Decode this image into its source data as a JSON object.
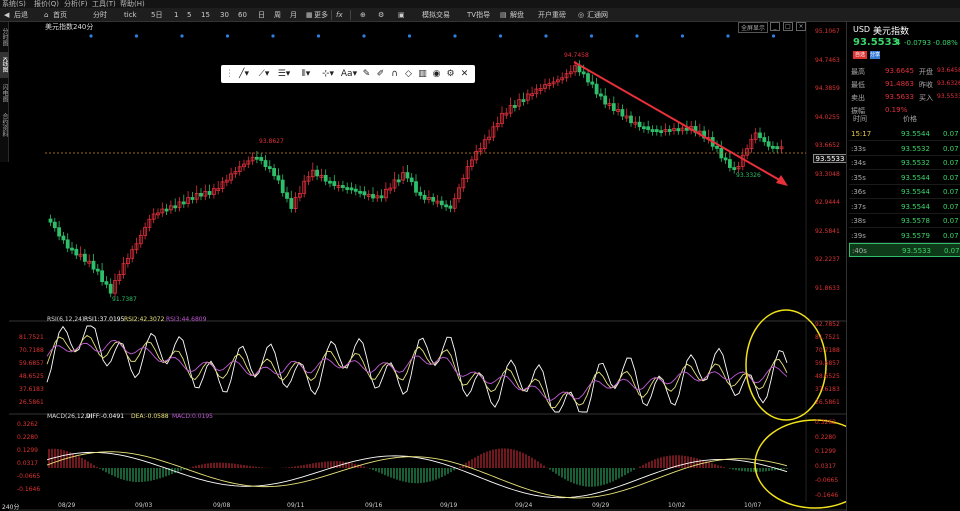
{
  "menubar": [
    "系统(S)",
    "报价(Q)",
    "分析(F)",
    "工具(T)",
    "帮助(H)"
  ],
  "toolbar": {
    "back": "后退",
    "home": "首页",
    "tab_fenshi": "分时",
    "tab_tick": "tick",
    "periods": [
      "5日",
      "1",
      "5",
      "15",
      "30",
      "60",
      "日",
      "周",
      "月"
    ],
    "more": "更多",
    "fx": "fx",
    "sim_trade": "模拟交易",
    "tv": "TV指导",
    "unlock": "解盘",
    "open": "开户重磅",
    "brand": "汇通网"
  },
  "left_tabs": [
    "分时图",
    "K线图",
    "闪电图",
    "合约资料"
  ],
  "main_chart": {
    "instrument": "美元指数",
    "period": "240分",
    "price_axis": [
      "95.1067",
      "94.7463",
      "94.3859",
      "94.0255",
      "93.6652",
      "93.3048",
      "92.9444",
      "92.5841",
      "92.2237",
      "91.8633"
    ],
    "current_price": "93.5533",
    "annotations": {
      "high": "94.7458",
      "peak1": "93.8627",
      "low": "91.7387",
      "recent_low": "93.3326"
    },
    "corner_label": "全屏显示"
  },
  "rsi": {
    "label": "RSI(6,12,24)",
    "rsi1": "RSI1:37.0195",
    "rsi2": "RSI2:42.3072",
    "rsi3": "RSI3:44.6809",
    "axis": [
      "92.7852",
      "81.7521",
      "70.7188",
      "59.6857",
      "48.6525",
      "37.6183",
      "26.5861"
    ]
  },
  "macd": {
    "label": "MACD(26,12,9)",
    "diff": "DIFF:-0.0491",
    "dea": "DEA:-0.0588",
    "macd": "MACD:0.0195",
    "axis": [
      "0.3262",
      "0.2280",
      "0.1299",
      "0.0317",
      "-0.0665",
      "-0.1646"
    ]
  },
  "dates": [
    "08/29",
    "09/03",
    "09/08",
    "09/11",
    "09/16",
    "09/19",
    "09/24",
    "09/29",
    "10/02",
    "10/07"
  ],
  "bottom_label": "240分",
  "right_panel": {
    "currency": "USD",
    "name": "美元指数",
    "price": "93.5533",
    "arrow": "⬇",
    "change": "-0.0793",
    "change_pct": "-0.08%",
    "buttons": [
      "自选",
      "分享"
    ],
    "stats": [
      {
        "label": "最高",
        "value": "93.6645",
        "label2": "开盘",
        "value2": "93.6458"
      },
      {
        "label": "最低",
        "value": "91.4863",
        "label2": "昨收",
        "value2": "93.6326"
      },
      {
        "label": "卖出",
        "value": "93.5633",
        "label2": "买入",
        "value2": "93.5533"
      },
      {
        "label": "振幅",
        "value": "0.19%",
        "label2": "",
        "value2": ""
      }
    ],
    "table_headers": [
      "时间",
      "价格"
    ],
    "trades": [
      {
        "time": "15:17",
        "price": "93.5544",
        "vol": "0.07"
      },
      {
        "time": ":33s",
        "price": "93.5532",
        "vol": "0.07"
      },
      {
        "time": ":34s",
        "price": "93.5532",
        "vol": "0.07"
      },
      {
        "time": ":35s",
        "price": "93.5544",
        "vol": "0.07"
      },
      {
        "time": ":36s",
        "price": "93.5544",
        "vol": "0.07"
      },
      {
        "time": ":37s",
        "price": "93.5544",
        "vol": "0.07"
      },
      {
        "time": ":38s",
        "price": "93.5578",
        "vol": "0.07"
      },
      {
        "time": ":39s",
        "price": "93.5579",
        "vol": "0.07"
      },
      {
        "time": ":40s",
        "price": "93.5533",
        "vol": "0.07"
      }
    ]
  },
  "colors": {
    "up": "#e0313c",
    "down": "#2fbe6a",
    "bg": "#000000",
    "price_green": "#3bd46a",
    "axis_red": "#d33",
    "highlight": "#f2e21a"
  }
}
